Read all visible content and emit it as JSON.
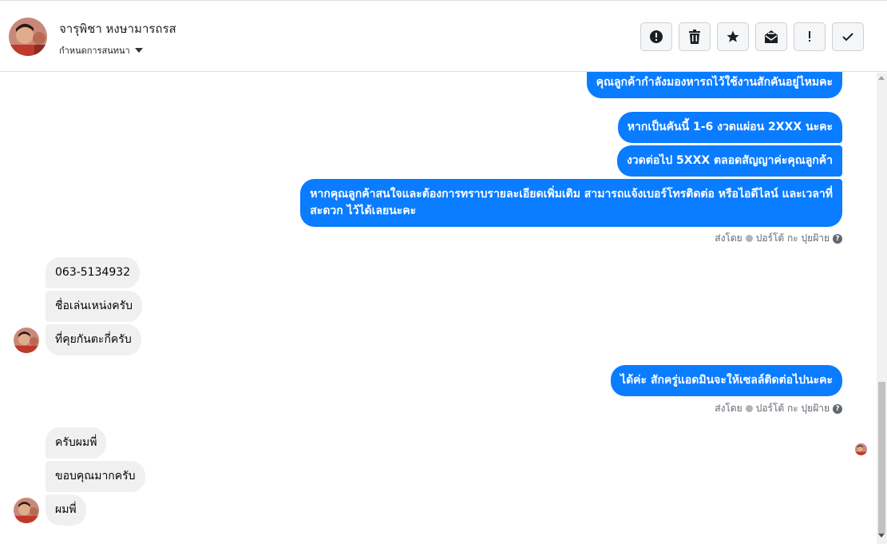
{
  "contact": {
    "name": "จารุพิชา หงษามารถรส",
    "subtitle": "กำหนดการสนทนา"
  },
  "toolbar": [
    {
      "icon": "alert-circle-icon",
      "glyph": "!"
    },
    {
      "icon": "trash-icon",
      "glyph": "🗑"
    },
    {
      "icon": "star-icon",
      "glyph": "★"
    },
    {
      "icon": "mail-open-icon",
      "glyph": "✉"
    },
    {
      "icon": "exclamation-icon",
      "glyph": "!"
    },
    {
      "icon": "check-icon",
      "glyph": "✓"
    }
  ],
  "messages": {
    "out_1": "คุณลูกค้ากำลังมองหารถไว้ใช้งานสักคันอยู่ไหมคะ",
    "out_2": "หากเป็นคันนี้ 1-6 งวดแผ่อน 2XXX  นะคะ",
    "out_3": "งวดต่อไป 5XXX  ตลอดสัญญาค่ะคุณลูกค้า",
    "out_4_line1": "หากคุณลูกค้าสนใจและต้องการทราบรายละเอียดเพิ่มเติม สามารถแจ้งเบอร์โทรติดต่อ หรือไอดีไลน์ และเวลาที่",
    "out_4_line2": "สะดวก ไว้ได้เลยนะคะ",
    "in_1": "063-5134932",
    "in_2": "ชื่อเล่นเหน่งครับ",
    "in_3": "ที่คุยกันตะกี่ครับ",
    "out_5": "ได้ค่ะ สักครู่แอดมินจะให้เซลล์ติดต่อไปนะคะ",
    "in_4": "ครับผมพี่",
    "in_5": "ขอบคุณมากครับ",
    "in_6": "ผมพี่"
  },
  "sent_by": {
    "label": "ส่งโดย",
    "agent": "ปอร์โต้ กะ ปุยฝ้าย"
  },
  "colors": {
    "outgoing": "#0a7cff",
    "incoming": "#f0f0f0"
  }
}
